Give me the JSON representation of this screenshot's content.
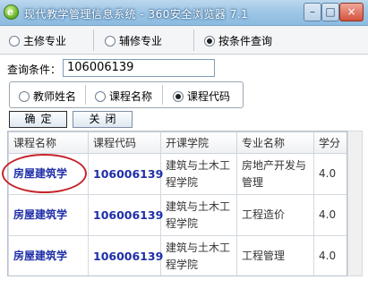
{
  "window": {
    "title": "现代教学管理信息系统 - 360安全浏览器 7.1",
    "minimize": "–",
    "maximize": "□",
    "close": "×"
  },
  "top_options": [
    {
      "label": "主修专业",
      "selected": false
    },
    {
      "label": "辅修专业",
      "selected": false
    },
    {
      "label": "按条件查询",
      "selected": true
    }
  ],
  "query": {
    "label": "查询条件：",
    "value": "106006139"
  },
  "search_options": [
    {
      "label": "教师姓名",
      "selected": false
    },
    {
      "label": "课程名称",
      "selected": false
    },
    {
      "label": "课程代码",
      "selected": true
    }
  ],
  "buttons": {
    "confirm": "确定",
    "close": "关闭"
  },
  "table": {
    "headers": [
      "课程名称",
      "课程代码",
      "开课学院",
      "专业名称",
      "学分"
    ],
    "rows": [
      [
        "房屋建筑学",
        "106006139",
        "建筑与土木工程学院",
        "房地产开发与管理",
        "4.0"
      ],
      [
        "房屋建筑学",
        "106006139",
        "建筑与土木工程学院",
        "工程造价",
        "4.0"
      ],
      [
        "房屋建筑学",
        "106006139",
        "建筑与土木工程学院",
        "工程管理",
        "4.0"
      ]
    ]
  },
  "colors": {
    "link": "#1f2fa8",
    "annotation": "#c6242a",
    "titlebar": "#9fc6e6"
  }
}
